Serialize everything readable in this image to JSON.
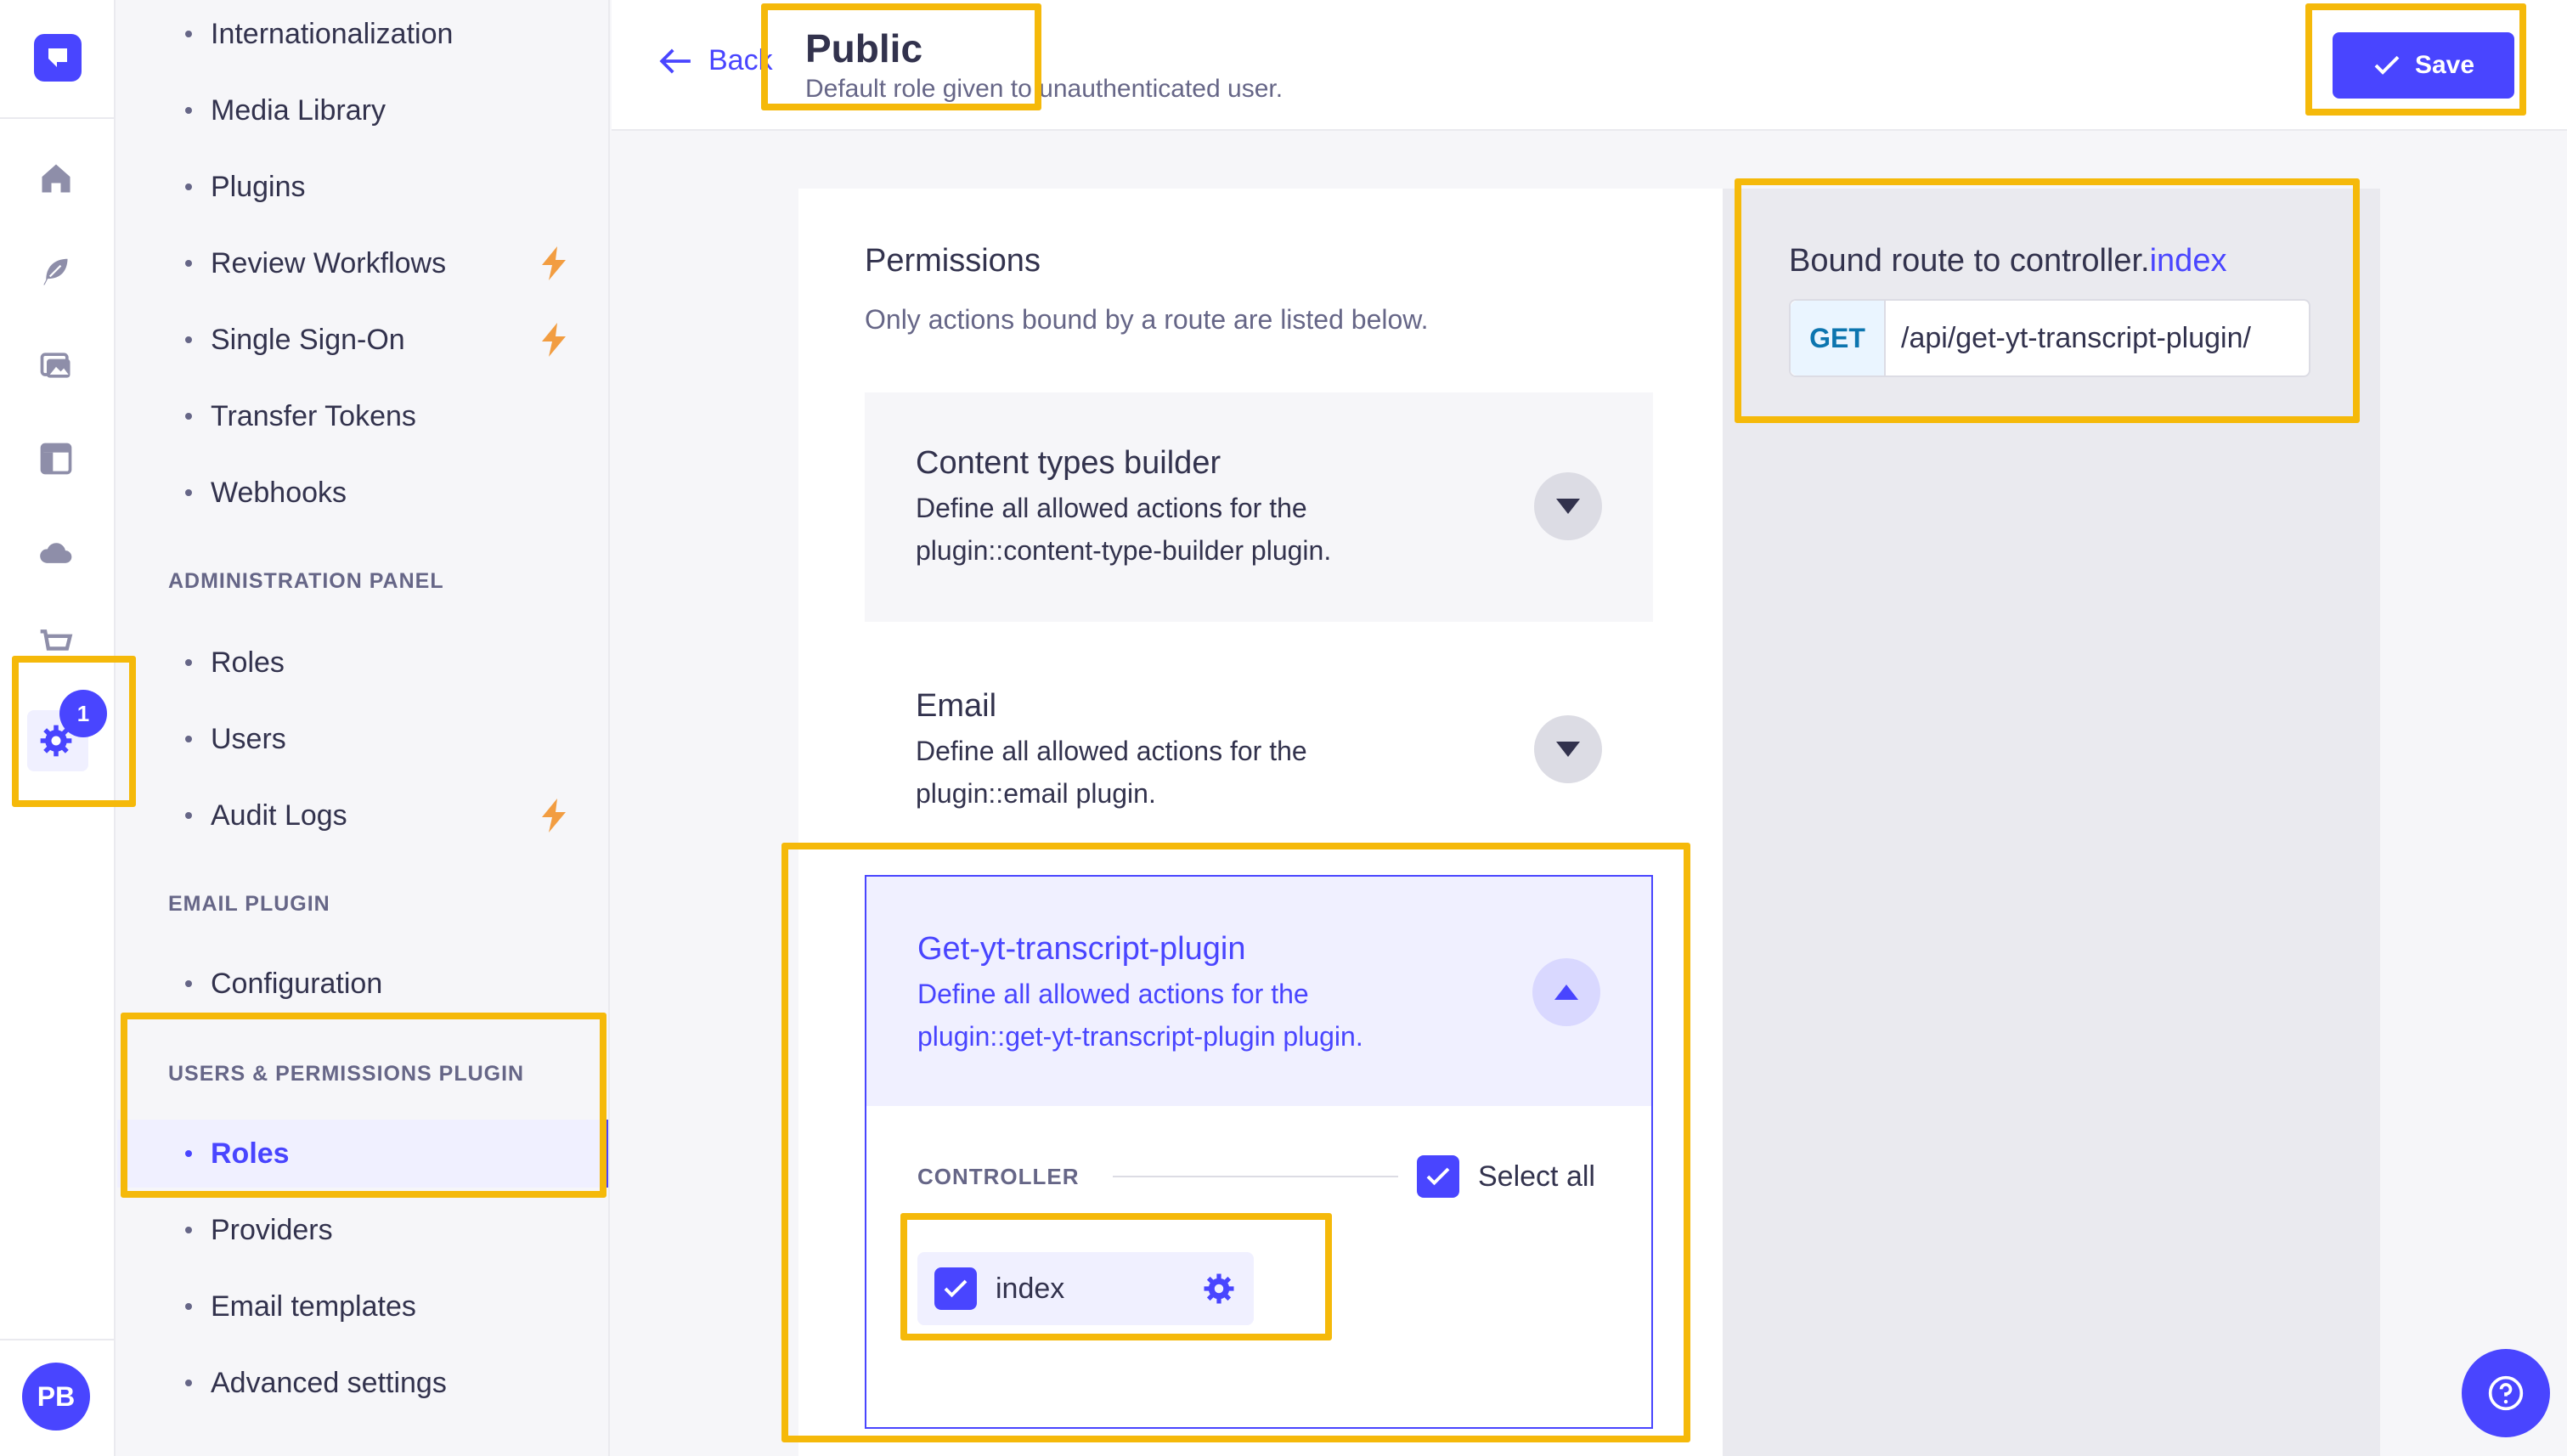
{
  "rail": {
    "avatar_initials": "PB",
    "settings_badge": "1",
    "icons": [
      "strapi-logo-icon",
      "home-icon",
      "feather-icon",
      "media-icon",
      "layout-icon",
      "cloud-icon",
      "cart-icon",
      "gear-icon"
    ]
  },
  "subnav": {
    "items_top": [
      {
        "label": "Internationalization",
        "pro": false
      },
      {
        "label": "Media Library",
        "pro": false
      },
      {
        "label": "Plugins",
        "pro": false
      },
      {
        "label": "Review Workflows",
        "pro": true
      },
      {
        "label": "Single Sign-On",
        "pro": true
      },
      {
        "label": "Transfer Tokens",
        "pro": false
      },
      {
        "label": "Webhooks",
        "pro": false
      }
    ],
    "section_admin": "ADMINISTRATION PANEL",
    "admin_items": [
      {
        "label": "Roles",
        "pro": false
      },
      {
        "label": "Users",
        "pro": false
      },
      {
        "label": "Audit Logs",
        "pro": true
      }
    ],
    "section_email": "EMAIL PLUGIN",
    "email_items": [
      {
        "label": "Configuration"
      }
    ],
    "section_up": "USERS & PERMISSIONS PLUGIN",
    "up_items": [
      {
        "label": "Roles",
        "active": true
      },
      {
        "label": "Providers",
        "active": false
      },
      {
        "label": "Email templates",
        "active": false
      },
      {
        "label": "Advanced settings",
        "active": false
      }
    ]
  },
  "header": {
    "back_label": "Back",
    "title": "Public",
    "subtitle": "Default role given to unauthenticated user.",
    "save_label": "Save"
  },
  "permissions": {
    "title": "Permissions",
    "subtitle": "Only actions bound by a route are listed below.",
    "accordions": [
      {
        "title": "Content types builder",
        "desc1": "Define all allowed actions for the",
        "desc2": "plugin::content-type-builder plugin.",
        "expanded": false
      },
      {
        "title": "Email",
        "desc1": "Define all allowed actions for the",
        "desc2": "plugin::email plugin.",
        "expanded": false
      },
      {
        "title": "Get-yt-transcript-plugin",
        "desc1": "Define all allowed actions for the",
        "desc2": "plugin::get-yt-transcript-plugin plugin.",
        "expanded": true
      }
    ],
    "controller_label": "CONTROLLER",
    "select_all_label": "Select all",
    "select_all_checked": true,
    "action": {
      "label": "index",
      "checked": true
    }
  },
  "route": {
    "title_prefix": "Bound route to controller.",
    "method_name": "index",
    "verb": "GET",
    "path": "/api/get-yt-transcript-plugin/"
  },
  "colors": {
    "primary": "#4945ff",
    "highlight": "#f5b90a",
    "pro_bolt": "#f29d41"
  }
}
